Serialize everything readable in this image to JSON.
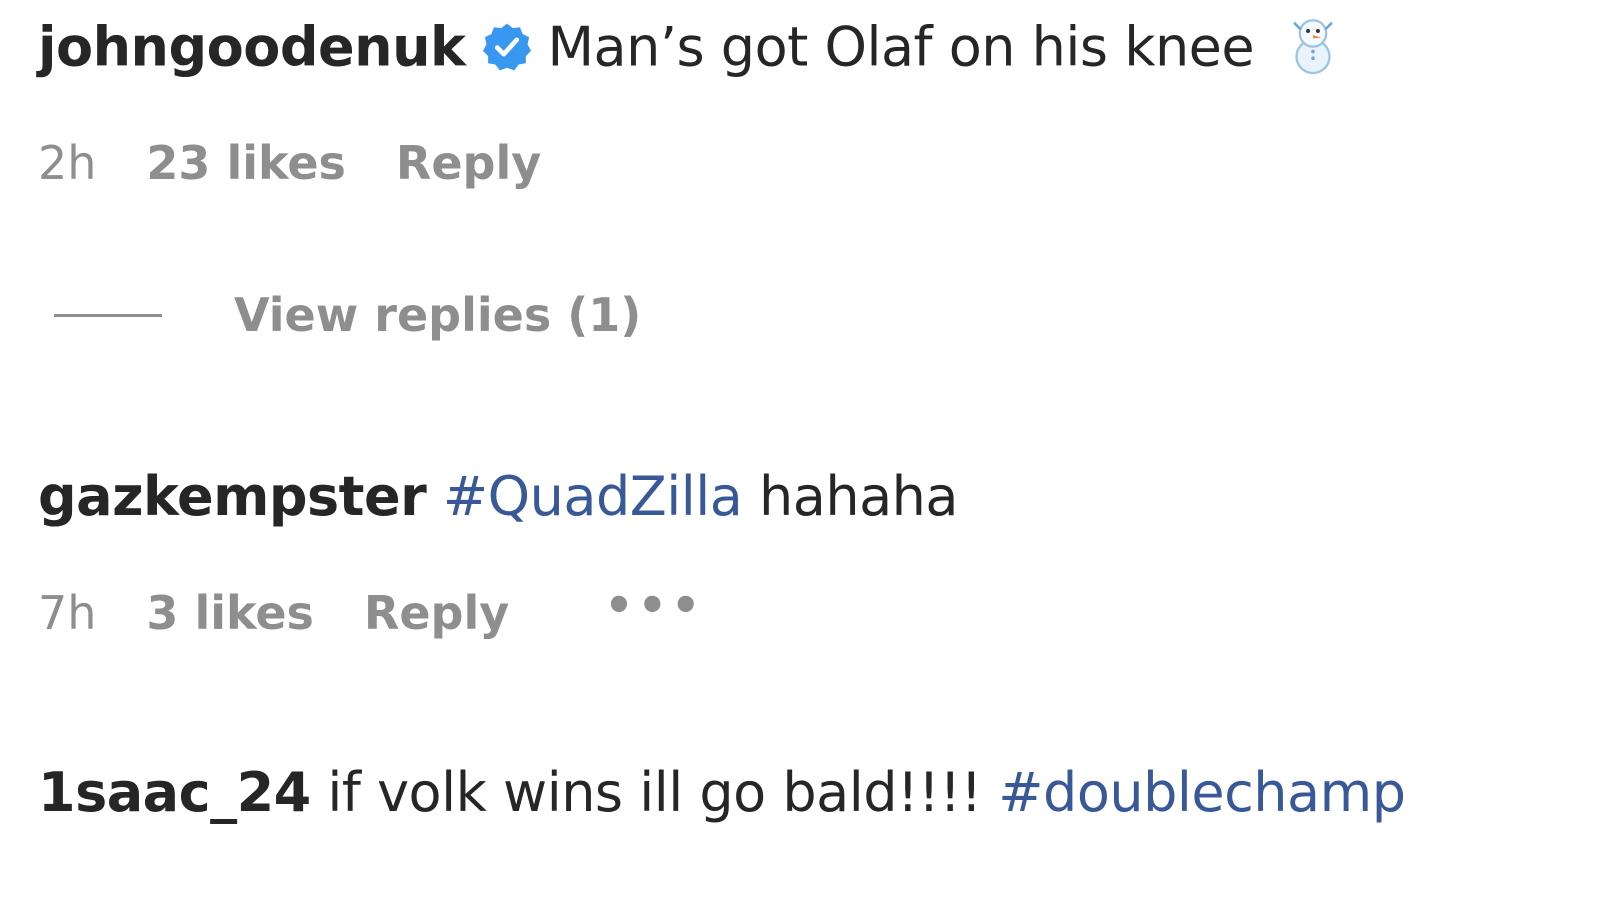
{
  "comments": [
    {
      "username": "johngoodenuk",
      "verified": true,
      "text": "Man’s got Olaf on his knee",
      "emoji_icon": "snowman-emoji-icon",
      "time": "2h",
      "likes": "23 likes",
      "reply_label": "Reply",
      "view_replies_label": "View replies (1)"
    },
    {
      "username": "gazkempster",
      "hashtag": "#QuadZilla",
      "text": "hahaha",
      "time": "7h",
      "likes": "3 likes",
      "reply_label": "Reply",
      "more_label": "•••"
    },
    {
      "username": "1saac_24",
      "text": "if volk wins ill go bald!!!!",
      "hashtag": "#doublechamp"
    }
  ],
  "colors": {
    "text": "#262626",
    "muted": "#8e8e8e",
    "hashtag": "#385898",
    "verified_badge": "#3897f0"
  }
}
